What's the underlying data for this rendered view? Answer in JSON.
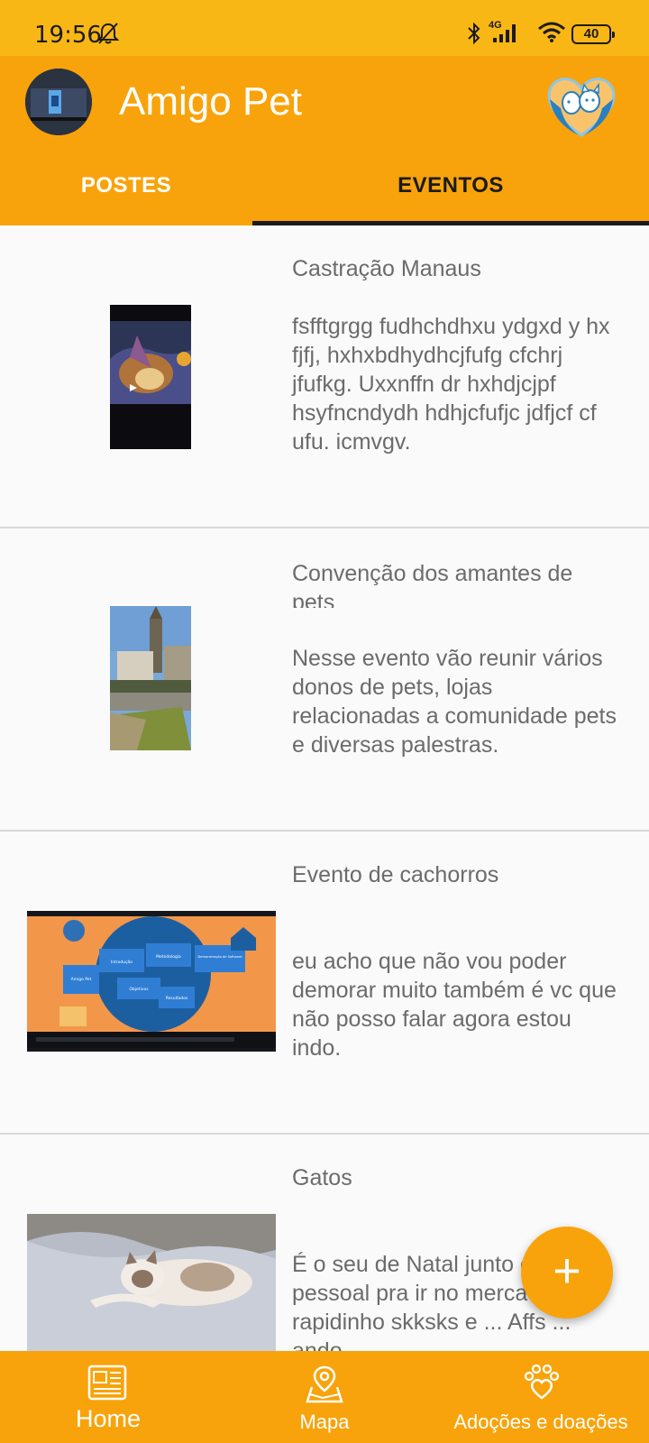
{
  "status_bar": {
    "time": "19:56",
    "network": "4G",
    "battery": "40"
  },
  "app_bar": {
    "title": "Amigo Pet",
    "tabs": [
      {
        "label": "POSTES",
        "selected": false
      },
      {
        "label": "EVENTOS",
        "selected": true
      }
    ]
  },
  "events": [
    {
      "title": "Castração Manaus",
      "description": "fsfftgrgg fudhchdhxu ydgxd y hx fjfj, hxhxbdhydhcjfufg cfchrj jfufkg. Uxxnffn dr hxhdjcjpf hsyfncndydh hdhjcfufjc jdfjcf cf ufu. icmvgv."
    },
    {
      "title": "Convenção dos amantes de pets",
      "description": "Nesse evento vão reunir vários donos de pets, lojas relacionadas a comunidade pets e diversas palestras."
    },
    {
      "title": "Evento de cachorros",
      "description": "eu acho que não vou poder demorar muito também é vc que não posso falar agora estou indo.",
      "thumb_labels": [
        "Introdução",
        "Metodologia",
        "Demonstração de Software",
        "Amigo Pet",
        "Objetivos",
        "Resultados"
      ]
    },
    {
      "title": "Gatos",
      "description": "É o seu de Natal junto com o pessoal pra ir no mercado rapidinho skksks e ... Affs ... ando"
    }
  ],
  "fab": {
    "icon": "plus-icon",
    "label": "+"
  },
  "bottom_nav": [
    {
      "label": "Home",
      "icon": "newspaper-icon"
    },
    {
      "label": "Mapa",
      "icon": "map-icon"
    },
    {
      "label": "Adoções e doações",
      "icon": "paw-heart-icon"
    }
  ],
  "colors": {
    "primary": "#f8a30b",
    "status_bar": "#f9b716",
    "text_secondary": "#6b6b6b",
    "tab_indicator": "#1a1a1a"
  }
}
